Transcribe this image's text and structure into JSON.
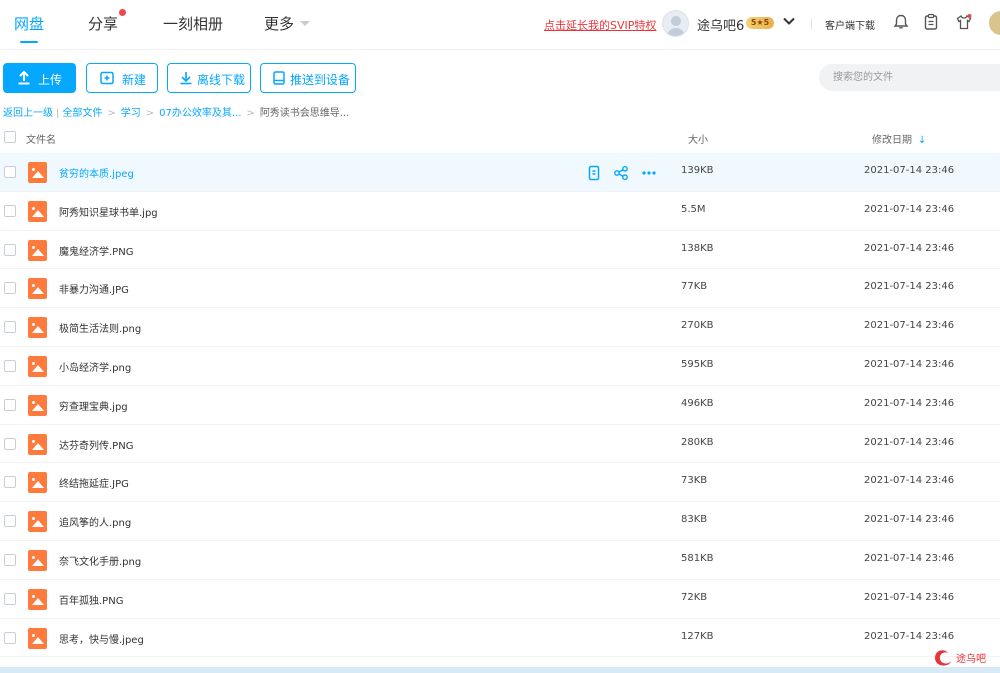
{
  "nav": {
    "tabs": [
      "网盘",
      "分享",
      "一刻相册",
      "更多"
    ],
    "svip_link": "点击延长我的SVIP特权",
    "username": "途乌吧6",
    "vip_level": "5",
    "client_download": "客户端下载"
  },
  "toolbar": {
    "upload": "上传",
    "new": "新建",
    "offline": "离线下载",
    "push": "推送到设备",
    "search_placeholder": "搜索您的文件"
  },
  "breadcrumb": {
    "back": "返回上一级",
    "all": "全部文件",
    "study": "学习",
    "folder": "07办公效率及其...",
    "current": "阿秀读书会思维导..."
  },
  "table": {
    "col_name": "文件名",
    "col_size": "大小",
    "col_date": "修改日期",
    "rows": [
      {
        "name": "贫穷的本质.jpeg",
        "size": "139KB",
        "date": "2021-07-14 23:46"
      },
      {
        "name": "阿秀知识星球书单.jpg",
        "size": "5.5M",
        "date": "2021-07-14 23:46"
      },
      {
        "name": "魔鬼经济学.PNG",
        "size": "138KB",
        "date": "2021-07-14 23:46"
      },
      {
        "name": "非暴力沟通.JPG",
        "size": "77KB",
        "date": "2021-07-14 23:46"
      },
      {
        "name": "极简生活法则.png",
        "size": "270KB",
        "date": "2021-07-14 23:46"
      },
      {
        "name": "小岛经济学.png",
        "size": "595KB",
        "date": "2021-07-14 23:46"
      },
      {
        "name": "穷查理宝典.jpg",
        "size": "496KB",
        "date": "2021-07-14 23:46"
      },
      {
        "name": "达芬奇列传.PNG",
        "size": "280KB",
        "date": "2021-07-14 23:46"
      },
      {
        "name": "终结拖延症.JPG",
        "size": "73KB",
        "date": "2021-07-14 23:46"
      },
      {
        "name": "追风筝的人.png",
        "size": "83KB",
        "date": "2021-07-14 23:46"
      },
      {
        "name": "奈飞文化手册.png",
        "size": "581KB",
        "date": "2021-07-14 23:46"
      },
      {
        "name": "百年孤独.PNG",
        "size": "72KB",
        "date": "2021-07-14 23:46"
      },
      {
        "name": "思考，快与慢.jpeg",
        "size": "127KB",
        "date": "2021-07-14 23:46"
      }
    ]
  },
  "watermark": "途乌吧",
  "colors": {
    "accent": "#06a7ff",
    "svip_link": "#e8343b",
    "file_icon": "#ff7a3d",
    "row_hover": "#f0f9ff"
  }
}
